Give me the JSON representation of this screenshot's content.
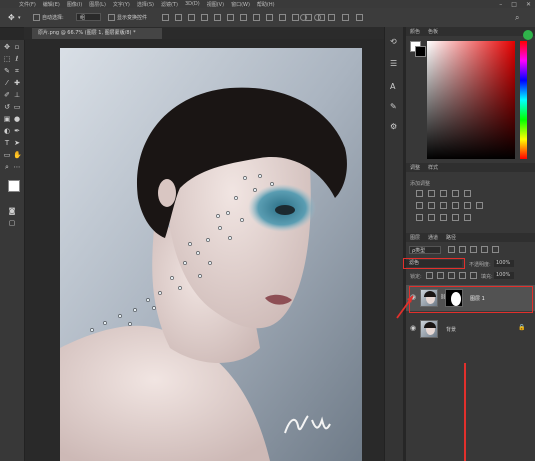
{
  "menubar": {
    "items": [
      "文件(F)",
      "编辑(E)",
      "图像(I)",
      "图层(L)",
      "文字(Y)",
      "选择(S)",
      "滤镜(T)",
      "3D(D)",
      "视图(V)",
      "窗口(W)",
      "帮助(H)"
    ]
  },
  "options": {
    "auto_select": "自动选择:",
    "group_value": "组",
    "transform_controls": "显示变换控件"
  },
  "document": {
    "tab_title": "原片.png @ 66.7% (图层 1, 图层蒙版/8) *"
  },
  "color_panel": {
    "tabs": [
      "颜色",
      "色板"
    ]
  },
  "adjust_panel": {
    "tabs": [
      "调整",
      "样式"
    ],
    "heading": "添加调整"
  },
  "layers_panel": {
    "tabs": [
      "图层",
      "通道",
      "路径"
    ],
    "kind_filter": "ρ类型",
    "blend_mode": "滤色",
    "opacity_label": "不透明度:",
    "opacity_value": "100%",
    "lock_label": "锁定:",
    "fill_label": "填充:",
    "fill_value": "100%",
    "layers": [
      {
        "name": "图层 1",
        "selected": true,
        "has_mask": true
      },
      {
        "name": "背景",
        "selected": false,
        "locked": true
      }
    ]
  },
  "colors": {
    "selection_red": "#e2302c",
    "accent_blue": "#2f78c8"
  },
  "photo": {
    "signature": "yu"
  }
}
